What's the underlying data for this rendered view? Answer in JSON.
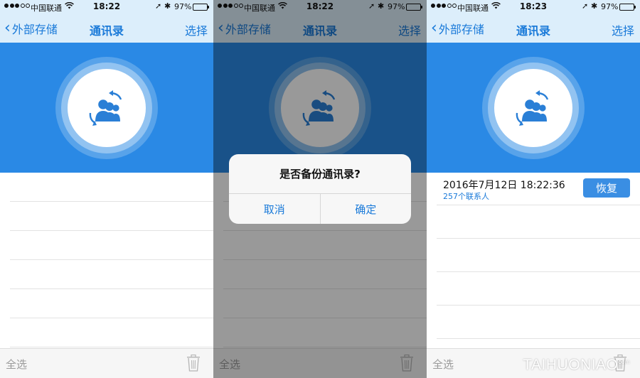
{
  "screens": [
    {
      "status": {
        "carrier": "中国联通",
        "time": "18:22",
        "battery": "97%"
      },
      "nav": {
        "back": "外部存储",
        "title": "通讯录",
        "select": "选择"
      },
      "toolbar": {
        "select_all": "全选"
      }
    },
    {
      "status": {
        "carrier": "中国联通",
        "time": "18:22",
        "battery": "97%"
      },
      "nav": {
        "back": "外部存储",
        "title": "通讯录",
        "select": "选择"
      },
      "toolbar": {
        "select_all": "全选"
      },
      "alert": {
        "message": "是否备份通讯录?",
        "cancel": "取消",
        "confirm": "确定"
      }
    },
    {
      "status": {
        "carrier": "中国联通",
        "time": "18:23",
        "battery": "97%"
      },
      "nav": {
        "back": "外部存储",
        "title": "通讯录",
        "select": "选择"
      },
      "toolbar": {
        "select_all": "全选"
      },
      "record": {
        "date": "2016年7月12日 18:22:36",
        "count": "257个联系人",
        "restore": "恢复"
      }
    }
  ],
  "battery_level": 0.97,
  "colors": {
    "accent": "#1a7ad9",
    "hero": "#2a89e5",
    "bar": "#dceefb",
    "hero_icon": "#2a7fd6"
  },
  "watermark": {
    "main": "TAIHUONIAO",
    "small": "com"
  }
}
